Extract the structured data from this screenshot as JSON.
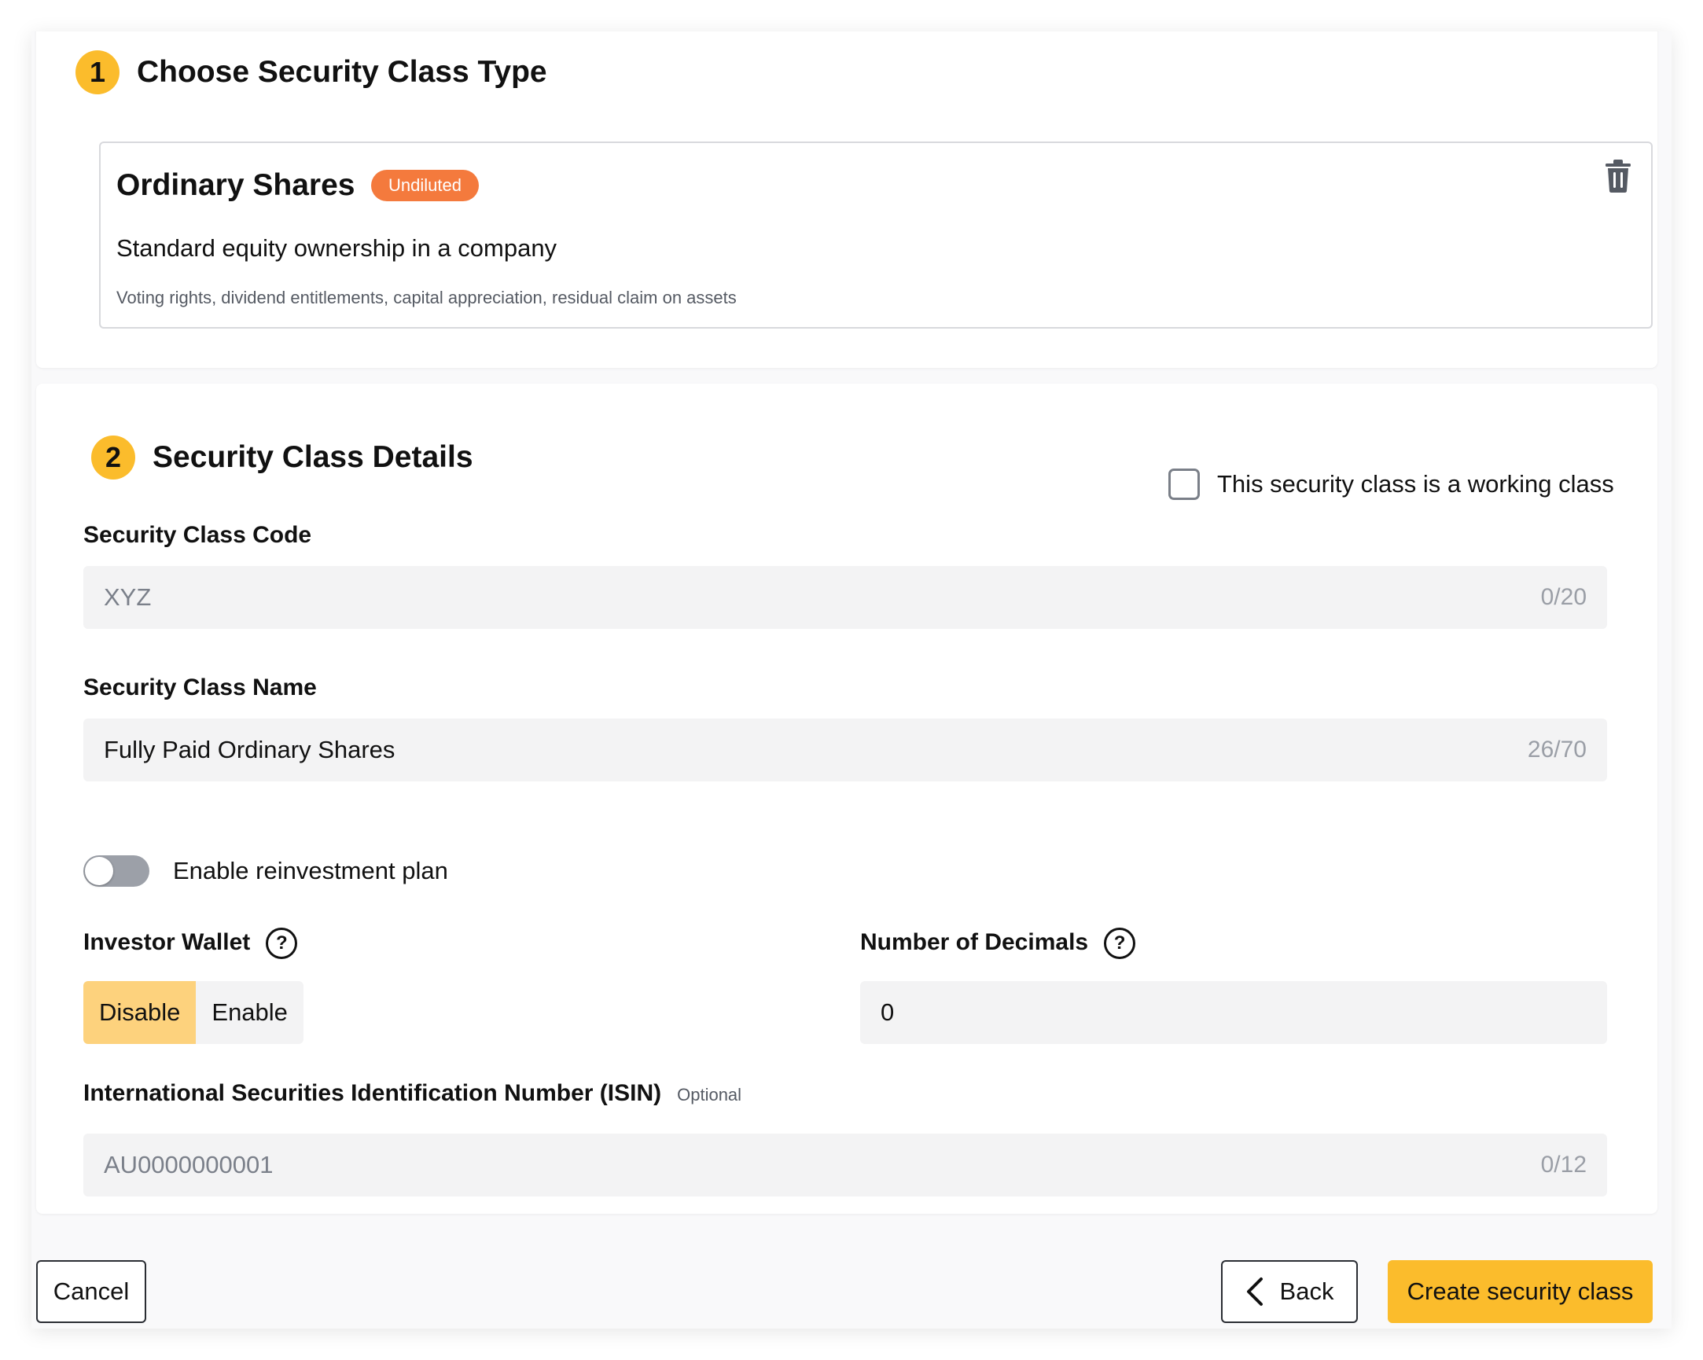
{
  "section1": {
    "step": "1",
    "title": "Choose Security Class Type",
    "share": {
      "name": "Ordinary Shares",
      "badge": "Undiluted",
      "description": "Standard equity ownership in a company",
      "features": "Voting rights, dividend entitlements, capital appreciation, residual claim on assets",
      "delete_icon": "trash-icon"
    }
  },
  "section2": {
    "step": "2",
    "title": "Security Class Details",
    "working_class": {
      "label": "This security class is a working class",
      "checked": false
    },
    "code": {
      "label": "Security Class Code",
      "placeholder": "XYZ",
      "value": "",
      "counter": "0/20"
    },
    "name": {
      "label": "Security Class Name",
      "value": "Fully Paid Ordinary Shares",
      "counter": "26/70"
    },
    "reinvestment": {
      "label": "Enable reinvestment plan",
      "enabled": false
    },
    "investor_wallet": {
      "label": "Investor Wallet",
      "options": [
        "Disable",
        "Enable"
      ],
      "selected": "Disable",
      "help_icon": "question-circle-icon"
    },
    "decimals": {
      "label": "Number of Decimals",
      "value": "0",
      "help_icon": "question-circle-icon"
    },
    "isin": {
      "label": "International Securities Identification Number (ISIN)",
      "optional": "Optional",
      "placeholder": "AU0000000001",
      "value": "",
      "counter": "0/12"
    }
  },
  "footer": {
    "cancel": "Cancel",
    "back": "Back",
    "create": "Create security class"
  },
  "colors": {
    "accent": "#fbbc2c",
    "badge": "#f47a3d",
    "segment_active": "#fdd27d",
    "input_bg": "#f3f3f4"
  }
}
